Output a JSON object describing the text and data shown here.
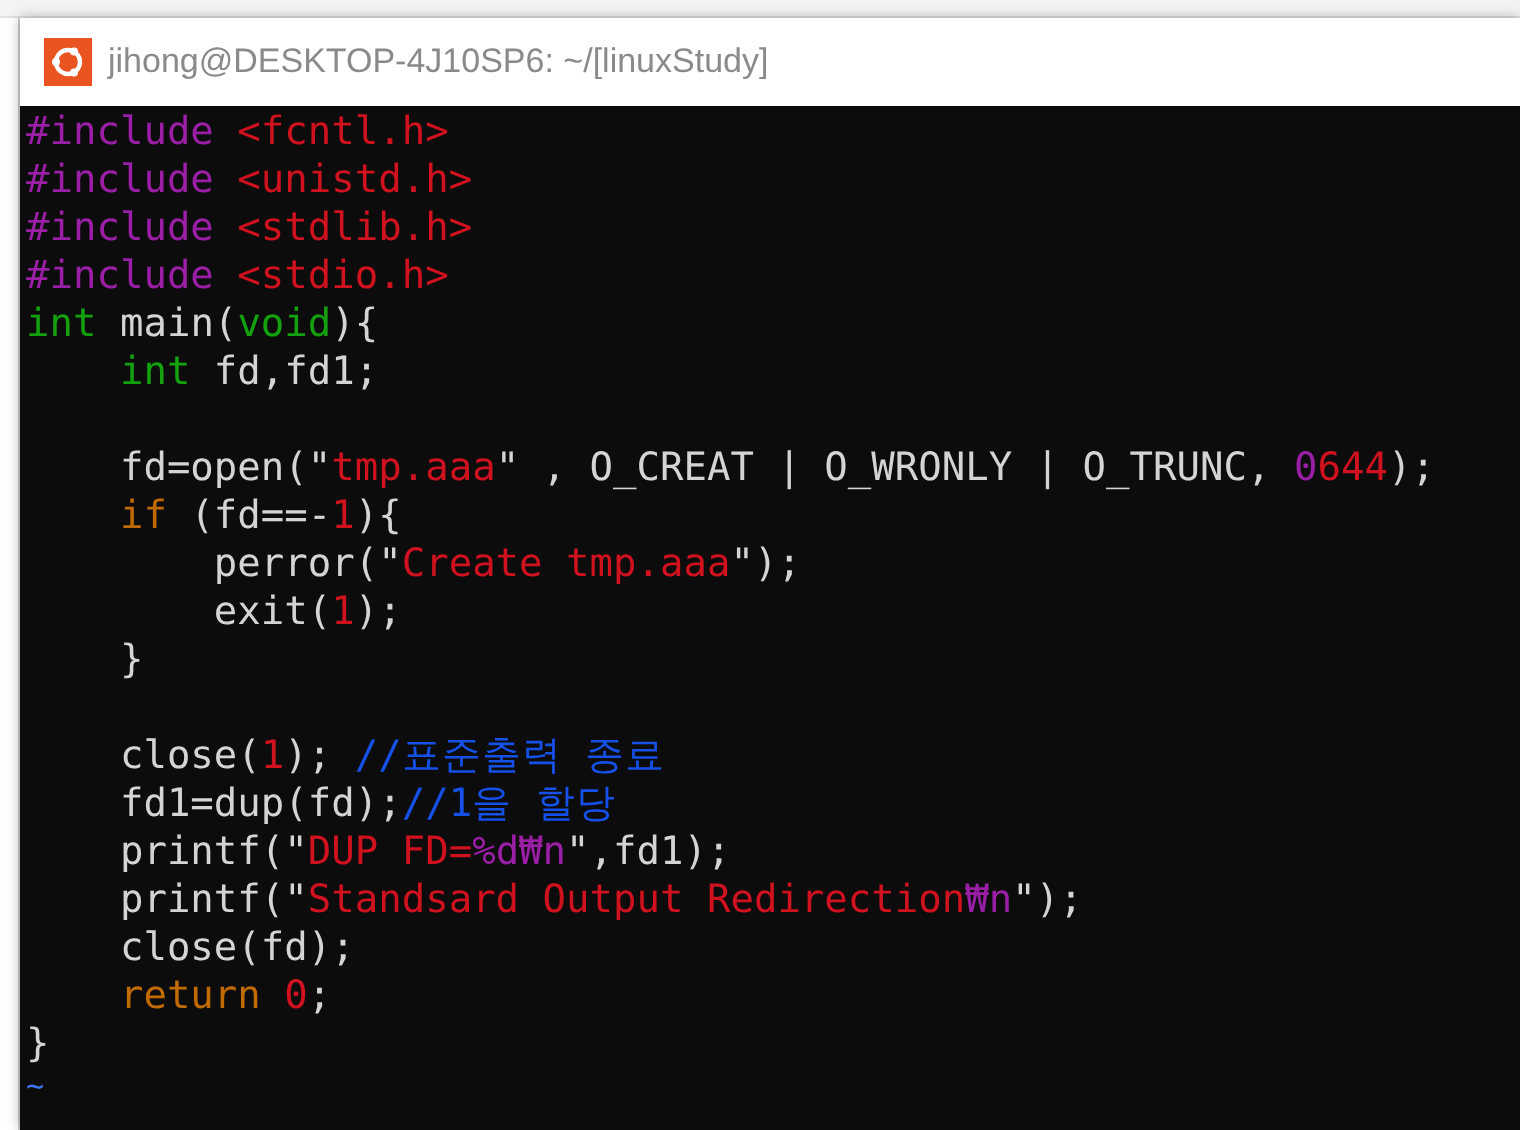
{
  "window": {
    "title": "jihong@DESKTOP-4J10SP6: ~/[linuxStudy]"
  },
  "editor": {
    "lines": [
      {
        "kind": "code",
        "tokens": [
          {
            "kind": "preproc",
            "text": "#include "
          },
          {
            "kind": "string",
            "text": "<fcntl.h>"
          }
        ]
      },
      {
        "kind": "code",
        "tokens": [
          {
            "kind": "preproc",
            "text": "#include "
          },
          {
            "kind": "string",
            "text": "<unistd.h>"
          }
        ]
      },
      {
        "kind": "code",
        "tokens": [
          {
            "kind": "preproc",
            "text": "#include "
          },
          {
            "kind": "string",
            "text": "<stdlib.h>"
          }
        ]
      },
      {
        "kind": "code",
        "tokens": [
          {
            "kind": "preproc",
            "text": "#include "
          },
          {
            "kind": "string",
            "text": "<stdio.h>"
          }
        ]
      },
      {
        "kind": "code",
        "tokens": [
          {
            "kind": "type",
            "text": "int"
          },
          {
            "kind": "plain",
            "text": " main("
          },
          {
            "kind": "type",
            "text": "void"
          },
          {
            "kind": "plain",
            "text": "){"
          }
        ]
      },
      {
        "kind": "code",
        "tokens": [
          {
            "kind": "type",
            "text": "    int"
          },
          {
            "kind": "plain",
            "text": " fd,fd1;"
          }
        ]
      },
      {
        "kind": "blank"
      },
      {
        "kind": "code",
        "tokens": [
          {
            "kind": "plain",
            "text": "    fd=open(\""
          },
          {
            "kind": "string",
            "text": "tmp.aaa"
          },
          {
            "kind": "plain",
            "text": "\" , O_CREAT | O_WRONLY | O_TRUNC, "
          },
          {
            "kind": "special",
            "text": "0"
          },
          {
            "kind": "string",
            "text": "644"
          },
          {
            "kind": "plain",
            "text": ");"
          }
        ]
      },
      {
        "kind": "code",
        "tokens": [
          {
            "kind": "keyword",
            "text": "    if"
          },
          {
            "kind": "plain",
            "text": " (fd==-"
          },
          {
            "kind": "string",
            "text": "1"
          },
          {
            "kind": "plain",
            "text": "){"
          }
        ]
      },
      {
        "kind": "code",
        "tokens": [
          {
            "kind": "plain",
            "text": "        perror(\""
          },
          {
            "kind": "string",
            "text": "Create tmp.aaa"
          },
          {
            "kind": "plain",
            "text": "\");"
          }
        ]
      },
      {
        "kind": "code",
        "tokens": [
          {
            "kind": "plain",
            "text": "        exit("
          },
          {
            "kind": "string",
            "text": "1"
          },
          {
            "kind": "plain",
            "text": ");"
          }
        ]
      },
      {
        "kind": "code",
        "tokens": [
          {
            "kind": "plain",
            "text": "    }"
          }
        ]
      },
      {
        "kind": "blank"
      },
      {
        "kind": "code",
        "tokens": [
          {
            "kind": "plain",
            "text": "    close("
          },
          {
            "kind": "string",
            "text": "1"
          },
          {
            "kind": "plain",
            "text": "); "
          },
          {
            "kind": "comment",
            "text": "//표준출력 종료"
          }
        ]
      },
      {
        "kind": "code",
        "tokens": [
          {
            "kind": "plain",
            "text": "    fd1=dup(fd);"
          },
          {
            "kind": "comment",
            "text": "//1을 할당"
          }
        ]
      },
      {
        "kind": "code",
        "tokens": [
          {
            "kind": "plain",
            "text": "    printf(\""
          },
          {
            "kind": "string",
            "text": "DUP FD="
          },
          {
            "kind": "special",
            "text": "%d₩n"
          },
          {
            "kind": "plain",
            "text": "\",fd1);"
          }
        ]
      },
      {
        "kind": "code",
        "tokens": [
          {
            "kind": "plain",
            "text": "    printf(\""
          },
          {
            "kind": "string",
            "text": "Standsard Output Redirection"
          },
          {
            "kind": "special",
            "text": "₩n"
          },
          {
            "kind": "plain",
            "text": "\");"
          }
        ]
      },
      {
        "kind": "code",
        "tokens": [
          {
            "kind": "plain",
            "text": "    close(fd);"
          }
        ]
      },
      {
        "kind": "code",
        "tokens": [
          {
            "kind": "keyword",
            "text": "    return "
          },
          {
            "kind": "string",
            "text": "0"
          },
          {
            "kind": "plain",
            "text": ";"
          }
        ]
      },
      {
        "kind": "code",
        "tokens": [
          {
            "kind": "plain",
            "text": "}"
          }
        ]
      },
      {
        "kind": "filler",
        "text": "~"
      }
    ]
  }
}
